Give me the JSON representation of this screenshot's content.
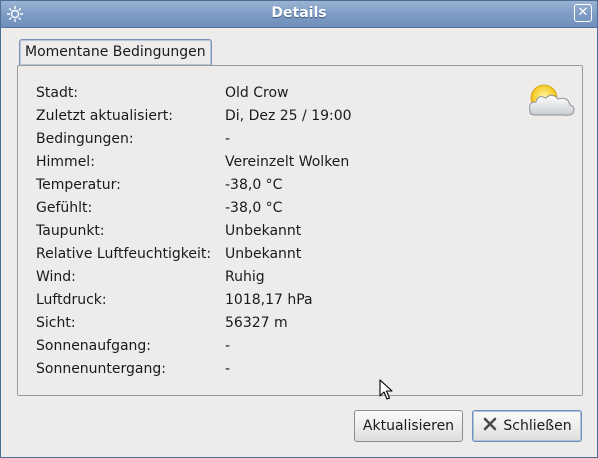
{
  "window": {
    "title": "Details"
  },
  "tabs": [
    {
      "label": "Momentane Bedingungen"
    }
  ],
  "details": [
    {
      "label": "Stadt:",
      "value": "Old Crow"
    },
    {
      "label": "Zuletzt aktualisiert:",
      "value": "Di, Dez 25 / 19:00"
    },
    {
      "label": "Bedingungen:",
      "value": "-"
    },
    {
      "label": "Himmel:",
      "value": "Vereinzelt Wolken"
    },
    {
      "label": "Temperatur:",
      "value": "-38,0 °C"
    },
    {
      "label": "Gefühlt:",
      "value": "-38,0 °C"
    },
    {
      "label": "Taupunkt:",
      "value": "Unbekannt"
    },
    {
      "label": "Relative Luftfeuchtigkeit:",
      "value": "Unbekannt"
    },
    {
      "label": "Wind:",
      "value": "Ruhig"
    },
    {
      "label": "Luftdruck:",
      "value": "1018,17 hPa"
    },
    {
      "label": "Sicht:",
      "value": "56327 m"
    },
    {
      "label": "Sonnenaufgang:",
      "value": "-"
    },
    {
      "label": "Sonnenuntergang:",
      "value": "-"
    }
  ],
  "buttons": {
    "refresh_label": "Aktualisieren",
    "close_label": "Schließen"
  },
  "icons": {
    "window": "weather-applet-icon",
    "titlebar_close": "close-icon",
    "conditions": "partly-cloudy-icon",
    "close_button": "close-x-icon"
  },
  "colors": {
    "titlebar": "#7e9cc5",
    "window_bg": "#edeceb",
    "focus_border": "#6f8fbc"
  }
}
